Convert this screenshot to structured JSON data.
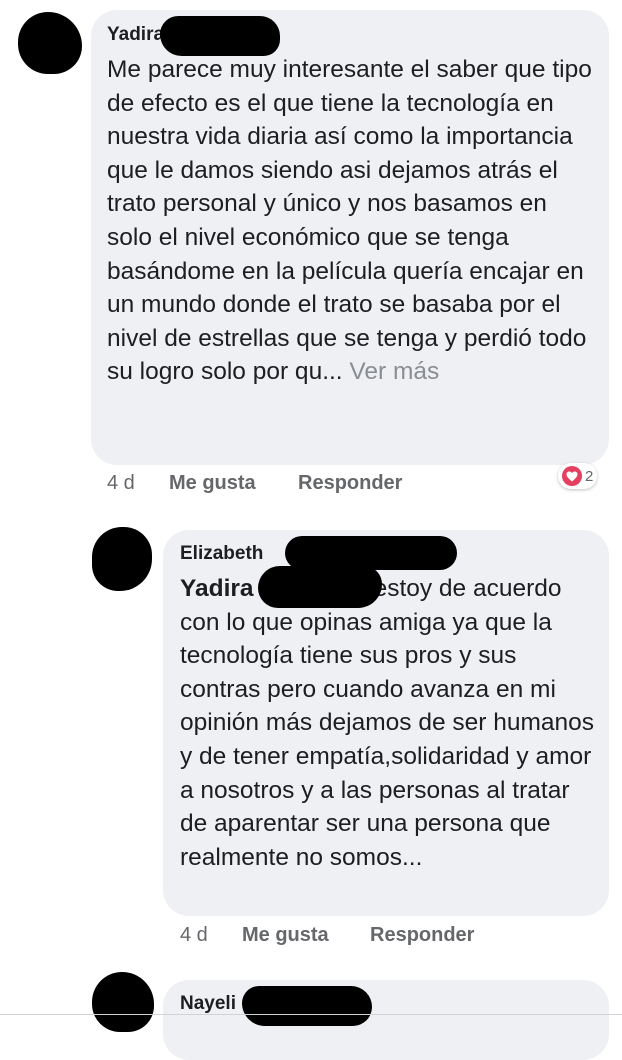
{
  "comments": [
    {
      "author": "Yadira",
      "text": "Me parece muy interesante el saber que tipo de efecto es el que  tiene la tecnología en nuestra vida diaria así como la importancia que le damos siendo asi dejamos atrás el trato personal y único y nos basamos en solo el nivel económico que se tenga basándome en la película quería encajar en un mundo donde el trato se basaba por el nivel de estrellas que se tenga y perdió todo su logro solo por qu...",
      "see_more": "Ver más",
      "time": "4 d",
      "like_label": "Me gusta",
      "reply_label": "Responder",
      "reaction_icon": "heart-icon",
      "reaction_count": "2"
    },
    {
      "author": "Elizabeth",
      "mention": "Yadira",
      "text": "estoy de acuerdo con lo que opinas amiga ya que la tecnología tiene sus pros y sus contras pero cuando avanza en mi opinión más dejamos de ser humanos y de tener empatía,solidaridad y amor a nosotros y a las personas al tratar de aparentar ser una persona que realmente no somos...",
      "time": "4 d",
      "like_label": "Me gusta",
      "reply_label": "Responder"
    },
    {
      "author": "Nayeli"
    }
  ],
  "colors": {
    "bubble": "#eff0f3",
    "meta": "#65676b",
    "heart": "#e4405f"
  }
}
